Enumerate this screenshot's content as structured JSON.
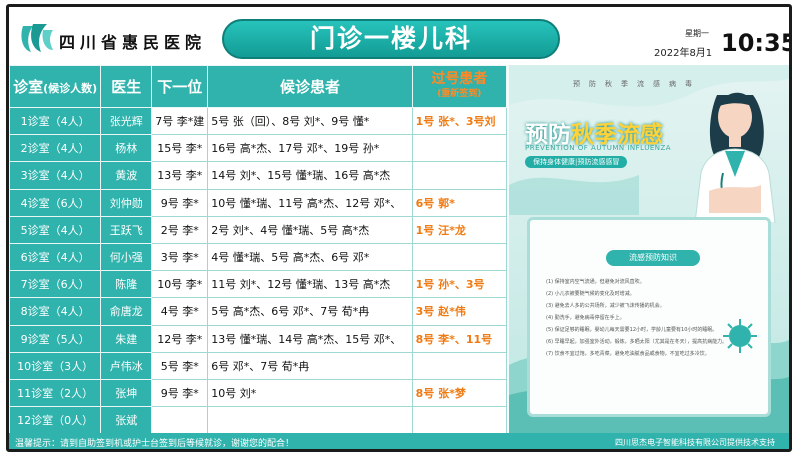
{
  "header": {
    "hospital_name": "四川省惠民医院",
    "department_title": "门诊一楼儿科",
    "weekday": "星期一",
    "date": "2022年8月1",
    "time": "10:35"
  },
  "table": {
    "headers": {
      "room": "诊室",
      "room_sub": "(候诊人数)",
      "doctor": "医生",
      "next": "下一位",
      "waiting": "候诊患者",
      "missed": "过号患者",
      "missed_sub": "(重新签到)"
    },
    "rows": [
      {
        "room": "1诊室（4人）",
        "doctor": "张光辉",
        "next": "7号 李*建",
        "waiting": "5号 张（回）、8号 刘*、9号 懂*",
        "missed": "1号 张*、3号刘"
      },
      {
        "room": "2诊室（4人）",
        "doctor": "杨林",
        "next": "15号 李*",
        "waiting": "16号 高*杰、17号 邓*、19号 孙*",
        "missed": ""
      },
      {
        "room": "3诊室（4人）",
        "doctor": "黄波",
        "next": "13号 李*",
        "waiting": "14号 刘*、15号 懂*瑞、16号 高*杰",
        "missed": ""
      },
      {
        "room": "4诊室（6人）",
        "doctor": "刘仲勋",
        "next": "9号 李*",
        "waiting": "10号 懂*瑞、11号 高*杰、12号 邓*、",
        "missed": "6号 郭*"
      },
      {
        "room": "5诊室（4人）",
        "doctor": "王跃飞",
        "next": "2号 李*",
        "waiting": "2号 刘*、4号 懂*瑞、5号 高*杰",
        "missed": "1号 汪*龙"
      },
      {
        "room": "6诊室（4人）",
        "doctor": "何小强",
        "next": "3号 李*",
        "waiting": "4号 懂*瑞、5号 高*杰、6号 邓*",
        "missed": ""
      },
      {
        "room": "7诊室（6人）",
        "doctor": "陈隆",
        "next": "10号 李*",
        "waiting": "11号 刘*、12号 懂*瑞、13号 高*杰",
        "missed": "1号 孙*、3号"
      },
      {
        "room": "8诊室（4人）",
        "doctor": "俞唐龙",
        "next": "4号 李*",
        "waiting": "5号 高*杰、6号 邓*、7号 荀*冉",
        "missed": "3号 赵*伟"
      },
      {
        "room": "9诊室（5人）",
        "doctor": "朱建",
        "next": "12号 李*",
        "waiting": "13号 懂*瑞、14号 高*杰、15号 邓*、",
        "missed": "8号 李*、11号"
      },
      {
        "room": "10诊室（3人）",
        "doctor": "卢伟冰",
        "next": "5号 李*",
        "waiting": "6号 邓*、7号 荀*冉",
        "missed": ""
      },
      {
        "room": "11诊室（2人）",
        "doctor": "张坤",
        "next": "9号 李*",
        "waiting": "10号 刘*",
        "missed": "8号 张*梦"
      },
      {
        "room": "12诊室（0人）",
        "doctor": "张斌",
        "next": "",
        "waiting": "",
        "missed": ""
      }
    ]
  },
  "poster": {
    "top_text": "预防秋季流感病毒",
    "title_part1": "预防",
    "title_part2": "秋季流感",
    "english": "PREVENTION OF AUTUMN INFLUENZA",
    "badge": "保持身体健康|预防流感感冒",
    "card_title": "流感预防知识",
    "tips": [
      "(1) 保持室内空气流通，但避免对流风直吹。",
      "(2) 小儿衣被要随气候的变化及时增减。",
      "(3) 避免去人多的公共场所，减少被飞沫传播的机会。",
      "(4) 勤洗手，避免病毒停留在手上。",
      "(5) 保证足够的睡眠，婴幼儿每天需要12小时，学龄儿童要有10小时的睡眠。",
      "(6) 早睡早起，加强室外活动，锻炼，多晒太阳（尤其是在冬天），提高抗病能力。",
      "(7) 饮食不宜过饱，多吃青菜，避免吃油腻食品或食物，不宜吃过多冷饮。"
    ]
  },
  "footer": {
    "notice": "温馨提示：请到自助签到机或护士台签到后等候就诊，谢谢您的配合！",
    "support": "四川思杰电子智能科技有限公司提供技术支持"
  },
  "colors": {
    "teal": "#2fb3ac",
    "orange": "#f07a12",
    "title_yellow": "#ffd23a"
  },
  "icons": [
    "hospital-logo-icon",
    "doctor-illustration-icon"
  ]
}
